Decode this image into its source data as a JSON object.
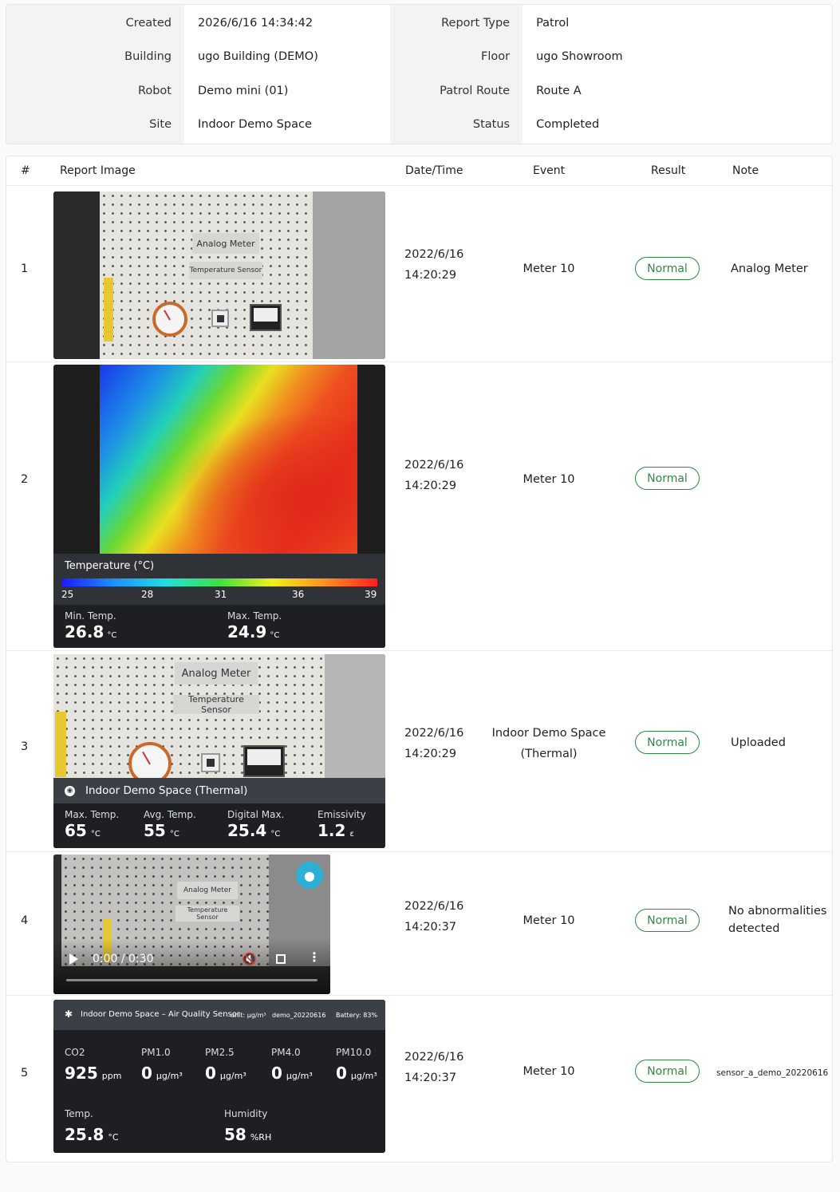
{
  "summary": {
    "left": [
      {
        "label": "Created",
        "value": "2026/6/16 14:34:42"
      },
      {
        "label": "Building",
        "value": "ugo Building (DEMO)"
      },
      {
        "label": "Robot",
        "value": "Demo mini (01)"
      },
      {
        "label": "Site",
        "value": "Indoor Demo Space"
      }
    ],
    "right": [
      {
        "label": "Report Type",
        "value": "Patrol"
      },
      {
        "label": "Floor",
        "value": "ugo Showroom"
      },
      {
        "label": "Patrol Route",
        "value": "Route A"
      },
      {
        "label": "Status",
        "value": "Completed"
      }
    ]
  },
  "table": {
    "headers": {
      "index": "#",
      "image": "Report Image",
      "datetime": "Date/Time",
      "event": "Event",
      "result": "Result",
      "note": "Note"
    },
    "rows": [
      {
        "index": "1",
        "date": "2022/6/16",
        "time": "14:20:29",
        "event": "Meter 10",
        "result": "Normal",
        "note": "Analog Meter"
      },
      {
        "index": "2",
        "date": "2022/6/16",
        "time": "14:20:29",
        "event": "Meter 10",
        "result": "Normal",
        "note": ""
      },
      {
        "index": "3",
        "date": "2022/6/16",
        "time": "14:20:29",
        "event_line1": "Indoor Demo Space",
        "event_line2": "(Thermal)",
        "result": "Normal",
        "note": "Uploaded"
      },
      {
        "index": "4",
        "date": "2022/6/16",
        "time": "14:20:37",
        "event": "Meter 10",
        "result": "Normal",
        "note": "No abnormalities detected"
      },
      {
        "index": "5",
        "date": "2022/6/16",
        "time": "14:20:37",
        "event": "Meter 10",
        "result": "Normal",
        "note": "sensor_a_demo_20220616"
      }
    ]
  },
  "images": {
    "photo1": {
      "sign_top": "Analog Meter",
      "sign_bottom": "Temperature Sensor"
    },
    "thermal": {
      "title": "Temperature (°C)",
      "scale": [
        "25",
        "28",
        "31",
        "36",
        "39"
      ],
      "min_label": "Min. Temp.",
      "min_value": "26.8",
      "min_unit": "°C",
      "max_label": "Max. Temp.",
      "max_value": "24.9",
      "max_unit": "°C"
    },
    "thermal_cam": {
      "sign_top": "Analog Meter",
      "sign_bottom": "Temperature Sensor",
      "bar_title": "Indoor Demo Space (Thermal)",
      "stats": [
        {
          "label": "Max. Temp.",
          "value": "65",
          "unit": "°C"
        },
        {
          "label": "Avg. Temp.",
          "value": "55",
          "unit": "°C"
        },
        {
          "label": "Digital Max.",
          "value": "25.4",
          "unit": "°C"
        },
        {
          "label": "Emissivity",
          "value": "1.2",
          "unit": "ε"
        }
      ]
    },
    "video": {
      "sign_top": "Analog Meter",
      "sign_bottom": "Temperature Sensor",
      "time": "0:00 / 0:30"
    },
    "air_quality": {
      "title": "Indoor Demo Space – Air Quality Sensor",
      "unit": "unit: μg/m³",
      "id": "demo_20220616",
      "battery": "Battery: 83%",
      "metrics": [
        {
          "label": "CO2",
          "value": "925",
          "unit": "ppm"
        },
        {
          "label": "PM1.0",
          "value": "0",
          "unit": "μg/m³"
        },
        {
          "label": "PM2.5",
          "value": "0",
          "unit": "μg/m³"
        },
        {
          "label": "PM4.0",
          "value": "0",
          "unit": "μg/m³"
        },
        {
          "label": "PM10.0",
          "value": "0",
          "unit": "μg/m³"
        }
      ],
      "temp_label": "Temp.",
      "temp_value": "25.8",
      "temp_unit": "°C",
      "hum_label": "Humidity",
      "hum_value": "58",
      "hum_unit": "%RH"
    }
  },
  "colors": {
    "normal_badge": "#2e8b3e",
    "panel_dark": "#1e1f22",
    "panel_bar": "#3b4047"
  }
}
